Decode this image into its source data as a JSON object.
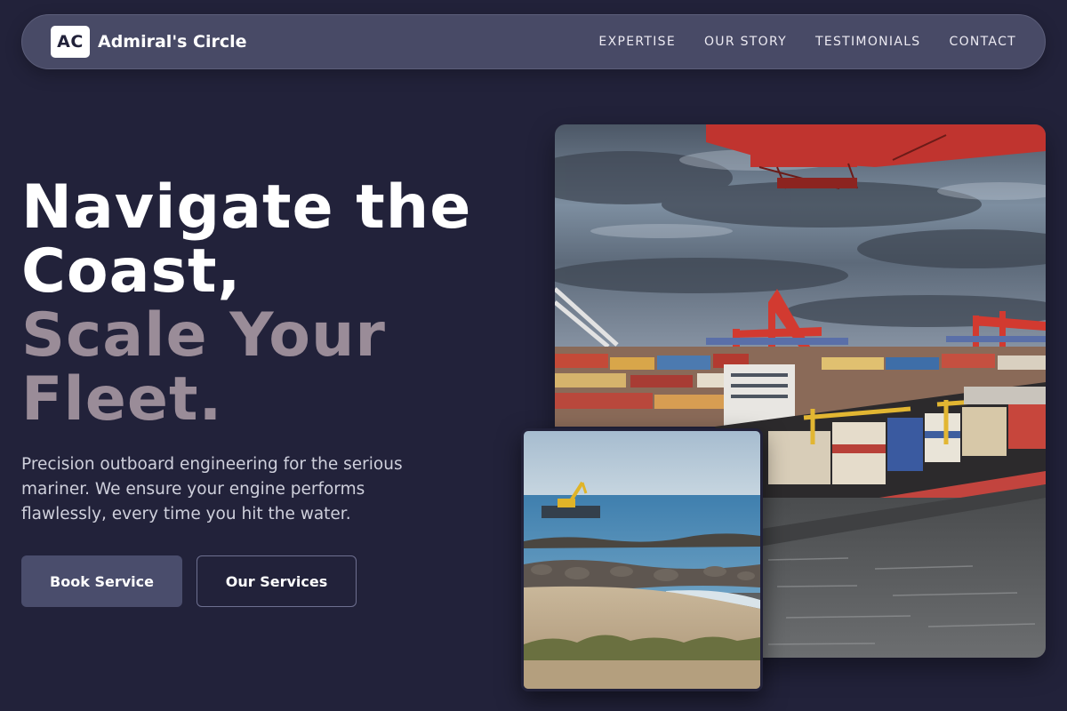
{
  "brand": {
    "logo_text": "AC",
    "name": "Admiral's Circle"
  },
  "nav": {
    "items": [
      {
        "label": "EXPERTISE"
      },
      {
        "label": "OUR STORY"
      },
      {
        "label": "TESTIMONIALS"
      },
      {
        "label": "CONTACT"
      }
    ]
  },
  "hero": {
    "title_line1": "Navigate the",
    "title_line2": "Coast,",
    "title_line3": "Scale Your",
    "title_line4": "Fleet.",
    "subtitle": "Precision outboard engineering for the serious mariner. We ensure your engine performs flawlessly, every time you hit the water.",
    "primary_button": "Book Service",
    "secondary_button": "Our Services"
  },
  "images": {
    "main": "container-port-photo",
    "inset": "coastal-breakwater-photo"
  },
  "colors": {
    "background": "#22223a",
    "nav_background": "#484a66",
    "title_accent": "#9a8c98",
    "primary_button": "#4a4d6c"
  }
}
